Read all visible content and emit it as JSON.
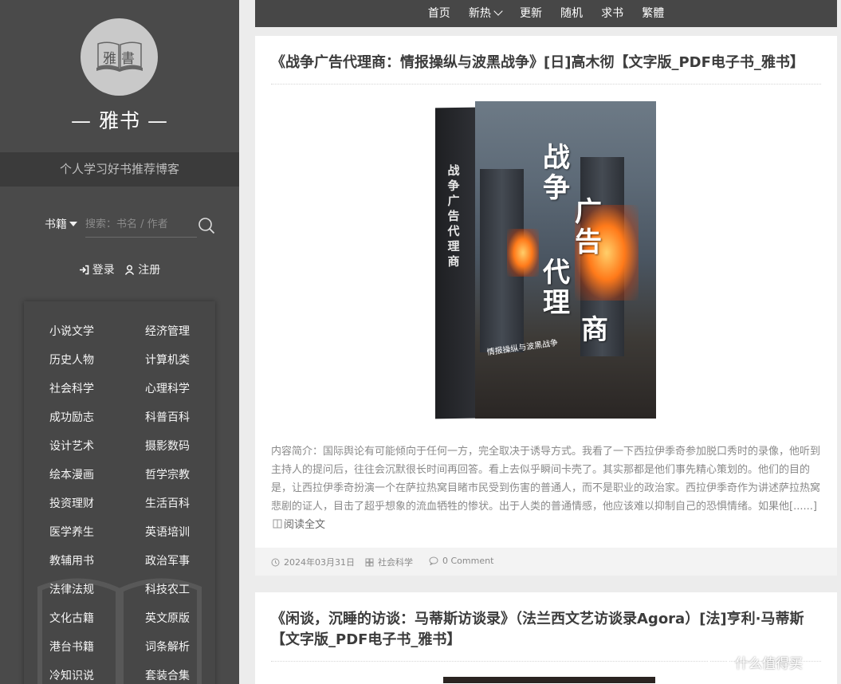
{
  "sidebar": {
    "logo_chars": [
      "雅",
      "書"
    ],
    "site_name": "— 雅书 —",
    "tagline": "个人学习好书推荐博客",
    "search": {
      "category": "书籍",
      "placeholder": "搜索：书名 / 作者"
    },
    "auth": {
      "login": "登录",
      "register": "注册"
    },
    "categories": [
      "小说文学",
      "经济管理",
      "历史人物",
      "计算机类",
      "社会科学",
      "心理科学",
      "成功励志",
      "科普百科",
      "设计艺术",
      "摄影数码",
      "绘本漫画",
      "哲学宗教",
      "投资理财",
      "生活百科",
      "医学养生",
      "英语培训",
      "教辅用书",
      "政治军事",
      "法律法规",
      "科技农工",
      "文化古籍",
      "英文原版",
      "港台书籍",
      "词条解析",
      "冷知识说",
      "套装合集"
    ]
  },
  "nav": {
    "items": [
      "首页",
      "新热",
      "更新",
      "随机",
      "求书",
      "繁體"
    ]
  },
  "posts": [
    {
      "title": "《战争广告代理商：情报操纵与波黑战争》[日]高木彻【文字版_PDF电子书_雅书】",
      "cover": {
        "title_chars": [
          "战争",
          "广告",
          "代理",
          "商"
        ],
        "subtitle": "情报操纵与波黑战争",
        "spine": "战争广告代理商"
      },
      "excerpt": "内容简介：国际舆论有可能倾向于任何一方，完全取决于诱导方式。我看了一下西拉伊季奇参加脱口秀时的录像，他听到主持人的提问后，往往会沉默很长时间再回答。看上去似乎瞬间卡壳了。其实那都是他们事先精心策划的。他们的目的是，让西拉伊季奇扮演一个在萨拉热窝目睹市民受到伤害的普通人，而不是职业的政治家。西拉伊季奇作为讲述萨拉热窝悲剧的证人，目击了超乎想象的流血牺牲的惨状。出于人类的普通情感，他应该难以抑制自己的恐惧情绪。如果他[......]",
      "read_more": "阅读全文",
      "date": "2024年03月31日",
      "category": "社会科学",
      "comments": "0 Comment"
    },
    {
      "title": "《闲谈，沉睡的访谈：马蒂斯访谈录》（法兰西文艺访谈录Agora）[法]亨利·马蒂斯【文字版_PDF电子书_雅书】"
    }
  ],
  "watermark": "什么值得买",
  "colors": {
    "sidebar_bg": "#4a4a4a",
    "tagline_bg": "#3b3b3b",
    "nav_bg": "#474747",
    "page_bg": "#ececec"
  }
}
